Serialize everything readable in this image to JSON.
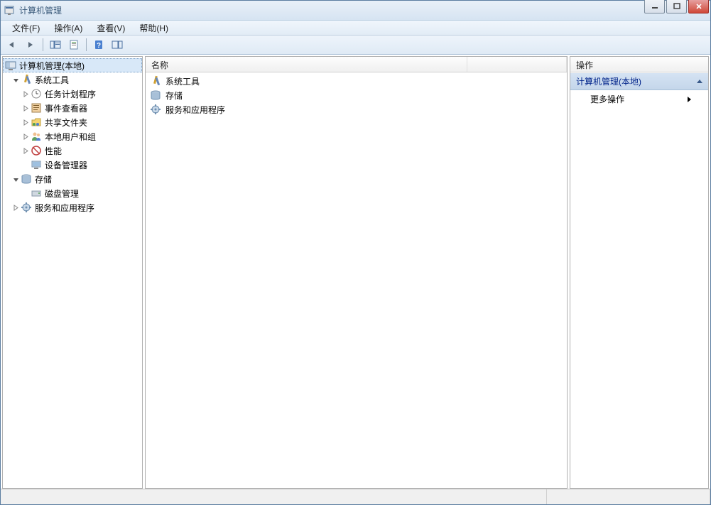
{
  "window": {
    "title": "计算机管理"
  },
  "menubar": {
    "file": "文件(F)",
    "action": "操作(A)",
    "view": "查看(V)",
    "help": "帮助(H)"
  },
  "tree": {
    "root": "计算机管理(本地)",
    "system_tools": "系统工具",
    "task_scheduler": "任务计划程序",
    "event_viewer": "事件查看器",
    "shared_folders": "共享文件夹",
    "local_users": "本地用户和组",
    "performance": "性能",
    "device_manager": "设备管理器",
    "storage": "存储",
    "disk_mgmt": "磁盘管理",
    "services_apps": "服务和应用程序"
  },
  "list": {
    "col_name": "名称",
    "items": {
      "system_tools": "系统工具",
      "storage": "存储",
      "services_apps": "服务和应用程序"
    }
  },
  "actions": {
    "header": "操作",
    "group": "计算机管理(本地)",
    "more": "更多操作"
  }
}
